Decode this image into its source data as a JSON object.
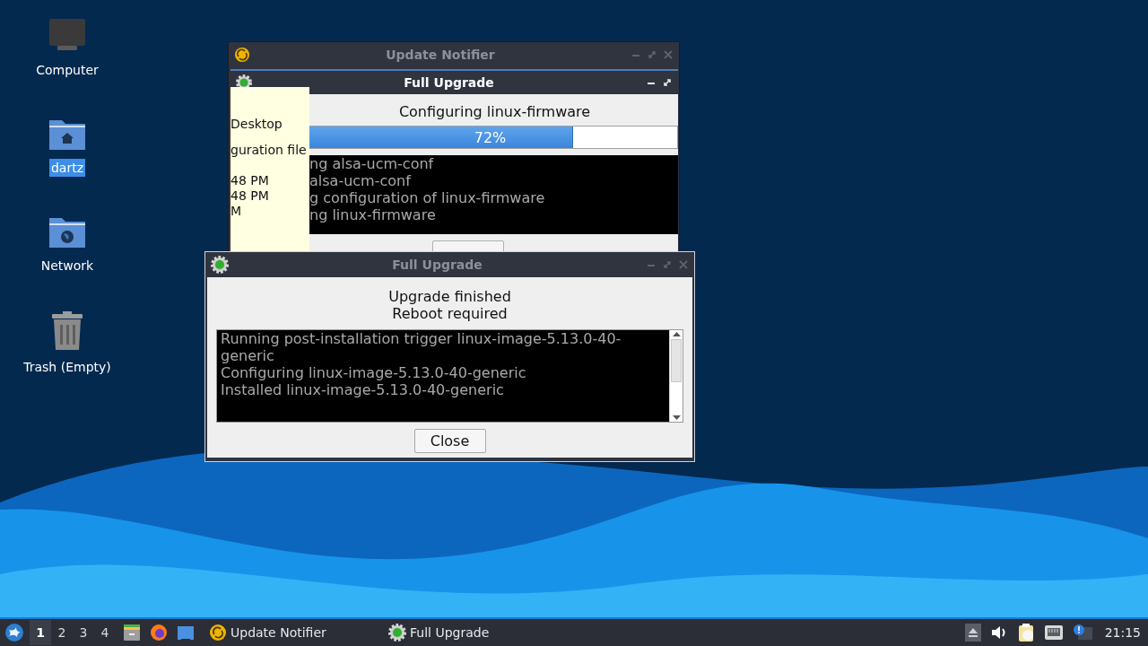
{
  "desktop_icons": [
    {
      "label": "Computer",
      "kind": "computer",
      "selected": false
    },
    {
      "label": "dartz",
      "kind": "home",
      "selected": true
    },
    {
      "label": "Network",
      "kind": "network",
      "selected": false
    },
    {
      "label": "Trash (Empty)",
      "kind": "trash",
      "selected": false
    }
  ],
  "update_notifier_window": {
    "title": "Update Notifier",
    "active": false
  },
  "progress_window": {
    "title": "Full Upgrade",
    "active": true,
    "status": "Configuring linux-firmware",
    "progress": {
      "level": 0.72,
      "reading": "72%"
    },
    "log_lines": [
      "ng alsa-ucm-conf",
      "alsa-ucm-conf",
      "g configuration of linux-firmware",
      "ng linux-firmware"
    ]
  },
  "tooltip": {
    "lines": [
      "Desktop",
      "guration file",
      "48 PM",
      "48 PM",
      "M"
    ]
  },
  "finished_dialog": {
    "title": "Full Upgrade",
    "active": false,
    "messages": [
      "Upgrade finished",
      "Reboot required"
    ],
    "log_lines": [
      "Running post-installation trigger linux-image-5.13.0-40-",
      "generic",
      "Configuring linux-image-5.13.0-40-generic",
      "Installed linux-image-5.13.0-40-generic"
    ],
    "button": "Close"
  },
  "taskbar": {
    "workspaces": [
      {
        "label": "1",
        "selected": true
      },
      {
        "label": "2",
        "selected": false
      },
      {
        "label": "3",
        "selected": false
      },
      {
        "label": "4",
        "selected": false
      }
    ],
    "launchers": [
      {
        "kind": "files"
      },
      {
        "kind": "browser"
      },
      {
        "kind": "desktop"
      }
    ],
    "tasks": [
      {
        "label": "Update Notifier",
        "kind": "notifier"
      },
      {
        "label": "Full Upgrade",
        "kind": "upgrade"
      }
    ],
    "tray": [
      {
        "kind": "eject"
      },
      {
        "kind": "volume"
      },
      {
        "kind": "clipboard"
      },
      {
        "kind": "network"
      },
      {
        "kind": "notice"
      }
    ],
    "clock": "21:15"
  }
}
